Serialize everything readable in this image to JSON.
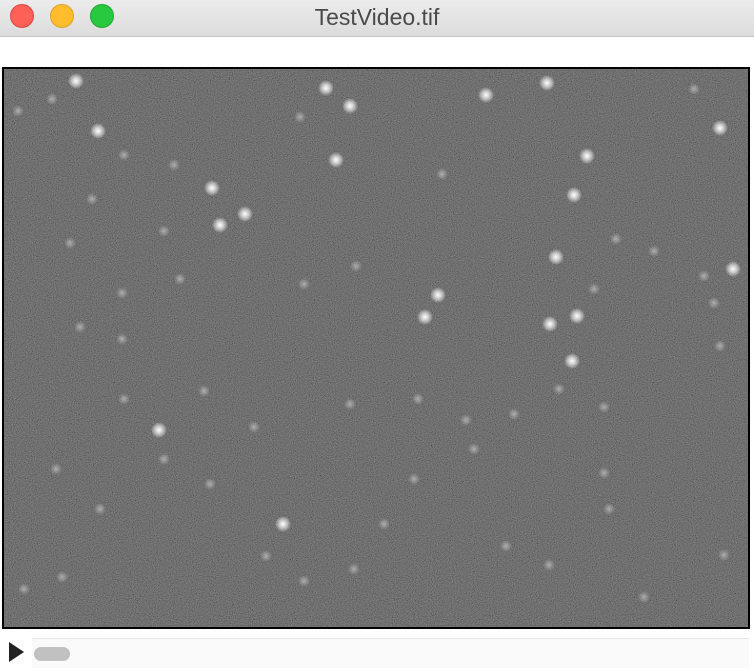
{
  "window": {
    "title": "TestVideo.tif",
    "buttons": {
      "close": "close-button",
      "minimize": "minimize-button",
      "zoom": "zoom-button"
    }
  },
  "image": {
    "description_type": "fluorescence-microscopy-frame",
    "background_color": "#252525"
  },
  "controls": {
    "play_icon": "play-icon",
    "frame_position_fraction": 0.0
  }
}
